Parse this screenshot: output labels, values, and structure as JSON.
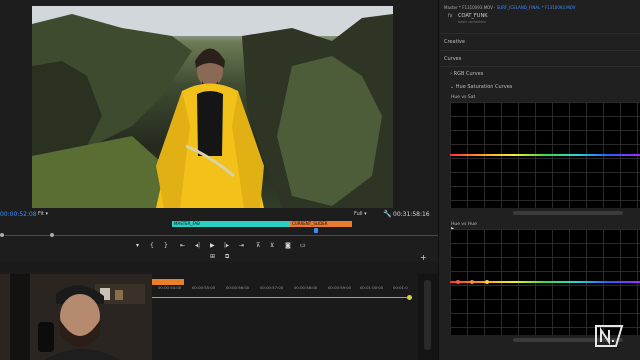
{
  "program_monitor": {
    "timecode_current": "00:00:52:08",
    "fit_label": "Fit",
    "quality_label": "Full",
    "timecode_duration": "00:31:58:16",
    "clips": [
      {
        "label": "MASTER_FAB",
        "color": "#2bd1c4"
      },
      {
        "label": "CURRENT_SLIDER",
        "color": "#e87b2e"
      }
    ]
  },
  "lumetri": {
    "master_prefix": "Master * F1310093.MOV",
    "master_sequence": "SURF_ICELAND_FINAL * F1310093.MOV",
    "fx_label": "fx",
    "look_label": "COAT_FUNK",
    "basic_label": "basic correction",
    "sections": {
      "creative": "Creative",
      "curves": "Curves",
      "rgb_curves": "RGB Curves",
      "hue_sat": "Hue Saturation Curves"
    },
    "graph1_label": "Hue vs Sat",
    "graph2_label": "Hue vs Hue"
  },
  "timeline": {
    "ticks": [
      "00:00:54:00",
      "00:00:55:00",
      "00:00:56:00",
      "00:00:57:00",
      "00:00:58:00",
      "00:00:59:00",
      "00:01:00:00",
      "00:01:0"
    ]
  },
  "colors": {
    "accent_blue": "#3d8bff",
    "playhead_orange": "#e8802b",
    "raincoat_yellow": "#f2c21a"
  },
  "icons": [
    "mark-in-icon",
    "mark-out-icon",
    "go-to-in-icon",
    "step-back-icon",
    "play-icon",
    "step-forward-icon",
    "go-to-out-icon",
    "lift-icon",
    "extract-icon",
    "export-frame-icon",
    "button-editor-icon",
    "wrench-icon",
    "add-icon",
    "logo-icon"
  ]
}
